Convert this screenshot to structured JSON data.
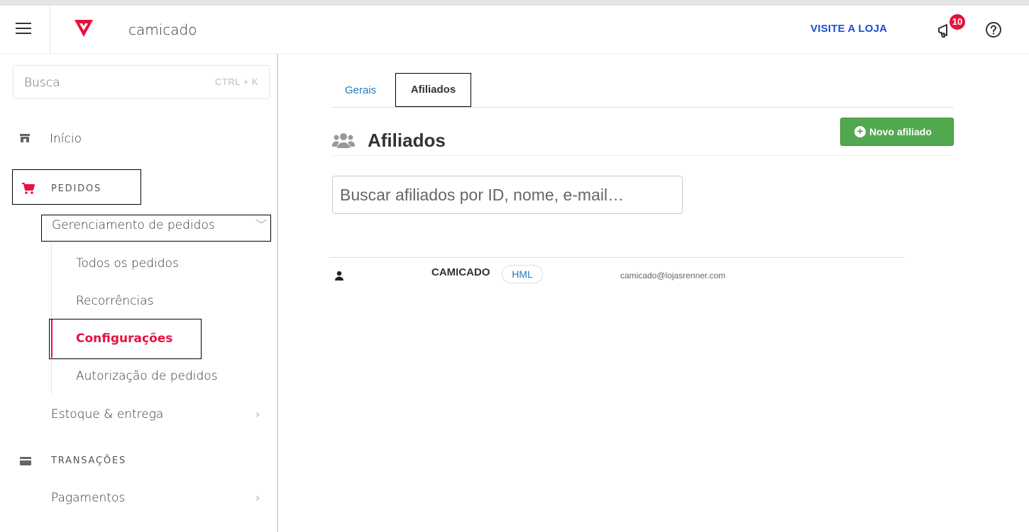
{
  "header": {
    "store_name": "camicado",
    "visit_store": "VISITE A LOJA",
    "notifications_count": "10",
    "brand_color": "#e8113e",
    "link_color": "#1a4fd6"
  },
  "sidebar": {
    "search_placeholder": "Busca",
    "search_shortcut": "CTRL + K",
    "inicio": "Início",
    "pedidos_section": "PEDIDOS",
    "gerenciamento": "Gerenciamento de pedidos",
    "sub_items": [
      "Todos os pedidos",
      "Recorrências",
      "Configurações",
      "Autorização de pedidos"
    ],
    "estoque": "Estoque & entrega",
    "transacoes_section": "TRANSAÇÕES",
    "pagamentos": "Pagamentos"
  },
  "main": {
    "tabs": [
      "Gerais",
      "Afiliados"
    ],
    "active_tab": "Afiliados",
    "title": "Afiliados",
    "new_button": "Novo afiliado",
    "search_placeholder": "Buscar afiliados por ID, nome, e-mail…",
    "affiliates": [
      {
        "name": "CAMICADO",
        "tag": "HML",
        "email": "camicado@lojasrenner.com"
      }
    ]
  },
  "icons": {
    "menu": "hamburger-icon",
    "logo": "vtex-logo",
    "notifications": "megaphone-icon",
    "help": "help-circle-icon",
    "home": "storefront-icon",
    "orders": "cart-icon",
    "transactions": "card-icon",
    "affiliates": "users-icon",
    "user": "user-icon"
  }
}
